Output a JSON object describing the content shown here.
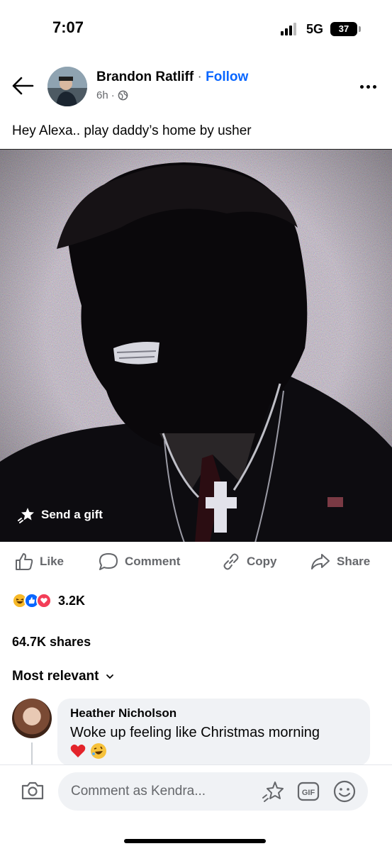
{
  "status_bar": {
    "time": "7:07",
    "network": "5G",
    "battery": "37"
  },
  "post": {
    "author": "Brandon Ratliff",
    "separator": "·",
    "follow_label": "Follow",
    "time": "6h",
    "meta_separator": "·",
    "privacy_icon": "globe-icon",
    "caption": "Hey Alexa.. play daddy’s home by usher",
    "send_gift_label": "Send a gift"
  },
  "actions": {
    "like": "Like",
    "comment": "Comment",
    "copy": "Copy",
    "share": "Share"
  },
  "engagement": {
    "reaction_icons": [
      "haha-icon",
      "like-icon",
      "love-icon"
    ],
    "reaction_count": "3.2K",
    "shares": "64.7K shares"
  },
  "comments": {
    "sort_label": "Most relevant",
    "items": [
      {
        "author": "Heather Nicholson",
        "text": "Woke up feeling like Christmas morning"
      }
    ]
  },
  "composer": {
    "placeholder": "Comment as Kendra...",
    "gif_label": "GIF"
  },
  "colors": {
    "accent": "#0866ff",
    "secondary_text": "#65676b",
    "bubble": "#f0f2f5"
  }
}
